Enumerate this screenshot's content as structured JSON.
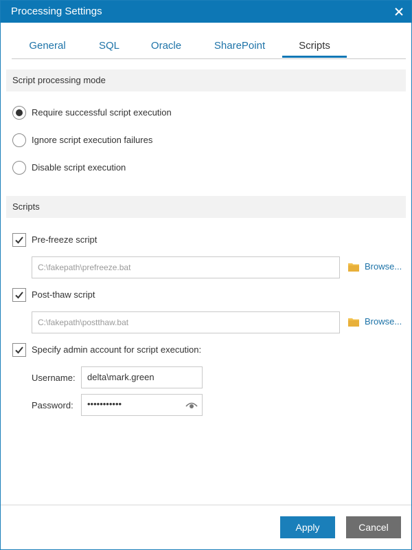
{
  "window": {
    "title": "Processing Settings"
  },
  "tabs": [
    {
      "label": "General"
    },
    {
      "label": "SQL"
    },
    {
      "label": "Oracle"
    },
    {
      "label": "SharePoint"
    },
    {
      "label": "Scripts",
      "active": true
    }
  ],
  "mode_section": {
    "header": "Script processing mode",
    "options": [
      {
        "label": "Require successful script execution",
        "selected": true
      },
      {
        "label": "Ignore script execution failures",
        "selected": false
      },
      {
        "label": "Disable script execution",
        "selected": false
      }
    ]
  },
  "scripts_section": {
    "header": "Scripts",
    "pre_freeze": {
      "label": "Pre-freeze script",
      "checked": true,
      "path": "C:\\fakepath\\prefreeze.bat",
      "browse": "Browse..."
    },
    "post_thaw": {
      "label": "Post-thaw script",
      "checked": true,
      "path": "C:\\fakepath\\postthaw.bat",
      "browse": "Browse..."
    },
    "admin": {
      "label": "Specify admin account for script execution:",
      "checked": true
    },
    "username": {
      "label": "Username:",
      "value": "delta\\mark.green"
    },
    "password": {
      "label": "Password:",
      "value": "•••••••••••"
    }
  },
  "footer": {
    "apply": "Apply",
    "cancel": "Cancel"
  },
  "colors": {
    "accent": "#0d77b5",
    "link": "#1d73a8",
    "cancel": "#6e6e6e",
    "folder": "#f2c14e"
  }
}
